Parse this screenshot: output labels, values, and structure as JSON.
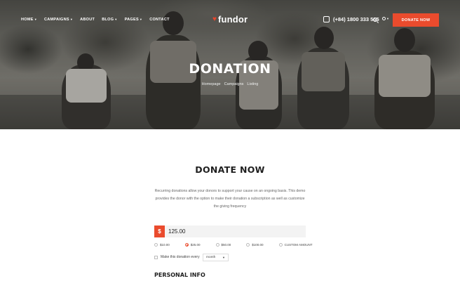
{
  "nav": {
    "menu": [
      {
        "label": "HOME",
        "caret": true
      },
      {
        "label": "CAMPAIGNS",
        "caret": true
      },
      {
        "label": "ABOUT",
        "caret": false
      },
      {
        "label": "BLOG",
        "caret": true
      },
      {
        "label": "PAGES",
        "caret": true
      },
      {
        "label": "CONTACT",
        "caret": false
      }
    ],
    "logo": "fundor",
    "phone": "(+84) 1800 333 555",
    "donate_button": "DONATE NOW"
  },
  "hero": {
    "title": "DONATION",
    "breadcrumb": [
      "Homepage",
      "Campaigns",
      "Listing"
    ]
  },
  "content": {
    "title": "DONATE NOW",
    "description": "Recurring donations allow your donors to support your cause on an ongoing basis. This demo provides the donor with the option to make their donation a subscription as well as customize the giving frequency",
    "currency_symbol": "$",
    "amount": "125.00",
    "amount_options": [
      {
        "label": "$10.00",
        "selected": false
      },
      {
        "label": "$25.00",
        "selected": true
      },
      {
        "label": "$50.00",
        "selected": false
      },
      {
        "label": "$100.00",
        "selected": false
      },
      {
        "label": "CUSTOM AMOUNT",
        "selected": false
      }
    ],
    "recurring_label": "Make this donation every",
    "frequency": "month",
    "personal_info": "PERSONAL INFO"
  },
  "colors": {
    "accent": "#ea4b2d"
  },
  "icons": [
    "heart-icon",
    "phone-icon",
    "search-icon",
    "user-icon",
    "chevron-down-icon"
  ]
}
